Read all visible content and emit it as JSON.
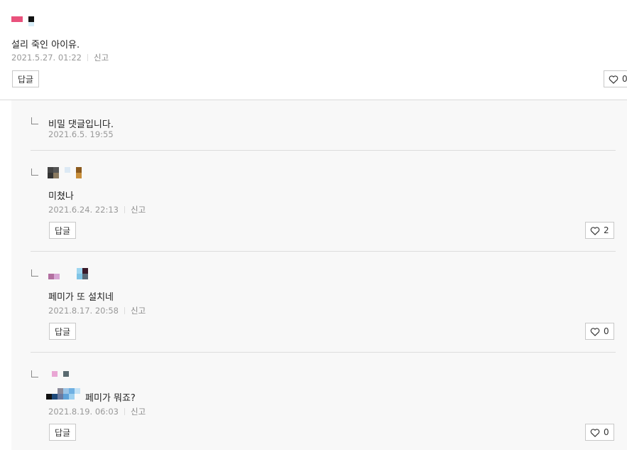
{
  "main_comment": {
    "text": "설리 죽인 아이유.",
    "date": "2021.5.27. 01:22",
    "report_label": "신고",
    "reply_label": "답글",
    "like_count": "0"
  },
  "replies": [
    {
      "text": "비밀 댓글입니다.",
      "date": "2021.6.5. 19:55"
    },
    {
      "text": "미쳤나",
      "date": "2021.6.24. 22:13",
      "report_label": "신고",
      "reply_label": "답글",
      "like_count": "2"
    },
    {
      "text": "페미가 또 설치네",
      "date": "2021.8.17. 20:58",
      "report_label": "신고",
      "reply_label": "답글",
      "like_count": "0"
    },
    {
      "text": "페미가 뭐죠?",
      "date": "2021.8.19. 06:03",
      "report_label": "신고",
      "reply_label": "답글",
      "like_count": "0"
    }
  ],
  "icons": {
    "like": "heart-outline-icon",
    "reply_indent": "reply-corner-icon"
  },
  "colors": {
    "report_text": "#888888",
    "meta_text": "#999999",
    "reply_background": "#f8f8f8"
  }
}
